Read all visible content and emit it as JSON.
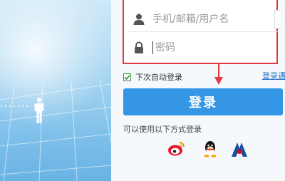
{
  "form": {
    "username_placeholder": "手机/邮箱/用户名",
    "password_placeholder": "密码",
    "auto_login_label": "下次自动登录",
    "auto_login_checked": true,
    "login_help_label": "登录遇",
    "login_button_label": "登录"
  },
  "other_login": {
    "label": "可以使用以下方式登录",
    "providers": [
      "weibo-icon",
      "qq-icon",
      "renren-icon"
    ]
  },
  "colors": {
    "highlight": "#e0393e",
    "primary_button": "#3596e6",
    "link": "#2c74c8"
  }
}
